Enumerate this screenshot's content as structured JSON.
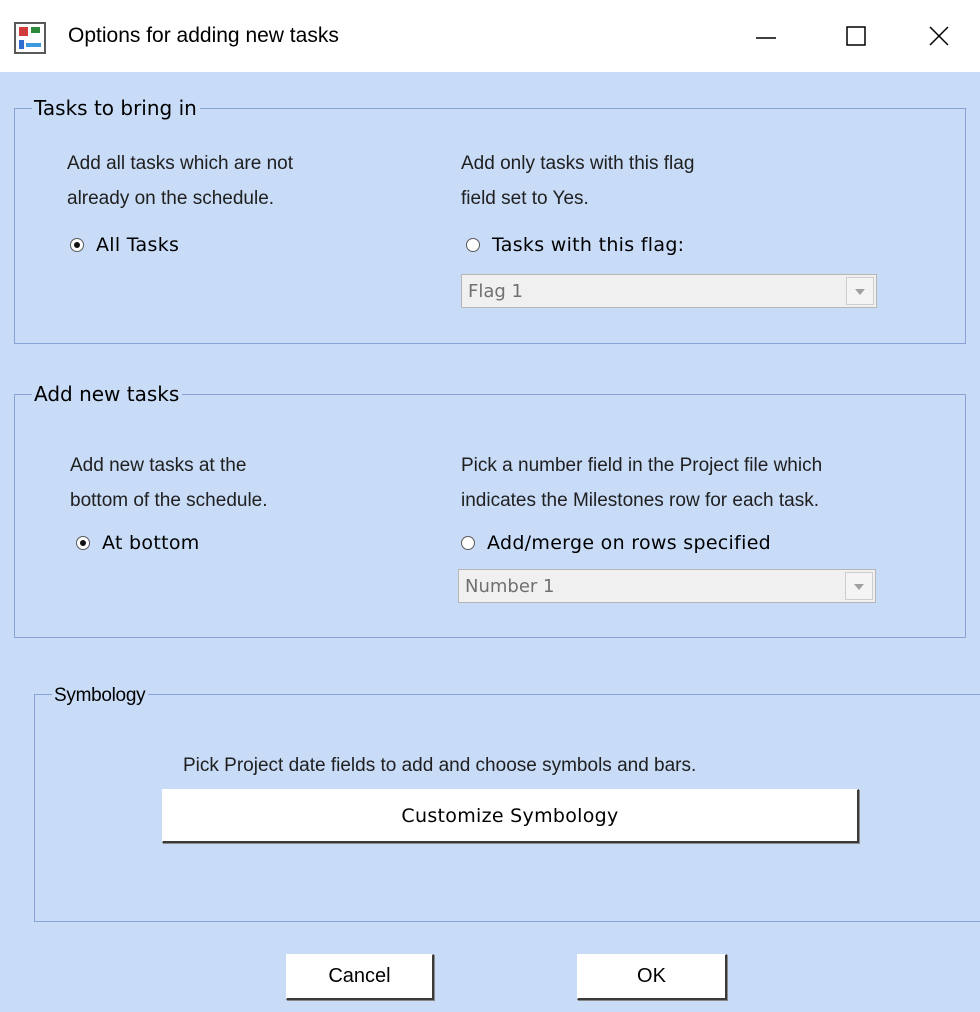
{
  "window": {
    "title": "Options for adding new tasks",
    "icon": "app-project-icon",
    "controls": {
      "minimize": "minimize-icon",
      "maximize": "maximize-icon",
      "close": "close-icon"
    }
  },
  "tasks_group": {
    "legend": "Tasks to bring in",
    "left_desc_line1": "Add all tasks which are not",
    "left_desc_line2": "already on the schedule.",
    "radio_all_label": "All Tasks",
    "radio_all_checked": true,
    "right_desc_line1": "Add only tasks with this flag",
    "right_desc_line2": "field set to Yes.",
    "radio_flag_label": "Tasks with this flag:",
    "radio_flag_checked": false,
    "flag_select_value": "Flag 1"
  },
  "add_group": {
    "legend": "Add new tasks",
    "left_desc_line1": "Add new tasks at the",
    "left_desc_line2": "bottom of the schedule.",
    "radio_bottom_label": "At bottom",
    "radio_bottom_checked": true,
    "right_desc_line1": "Pick a number field in the Project file which",
    "right_desc_line2": "indicates the Milestones row for each task.",
    "radio_rows_label": "Add/merge on rows specified",
    "radio_rows_checked": false,
    "number_select_value": "Number 1"
  },
  "symbology_group": {
    "legend": "Symbology",
    "desc": "Pick Project date fields to add and choose symbols and bars.",
    "button_label": "Customize Symbology"
  },
  "footer": {
    "cancel_label": "Cancel",
    "ok_label": "OK"
  }
}
